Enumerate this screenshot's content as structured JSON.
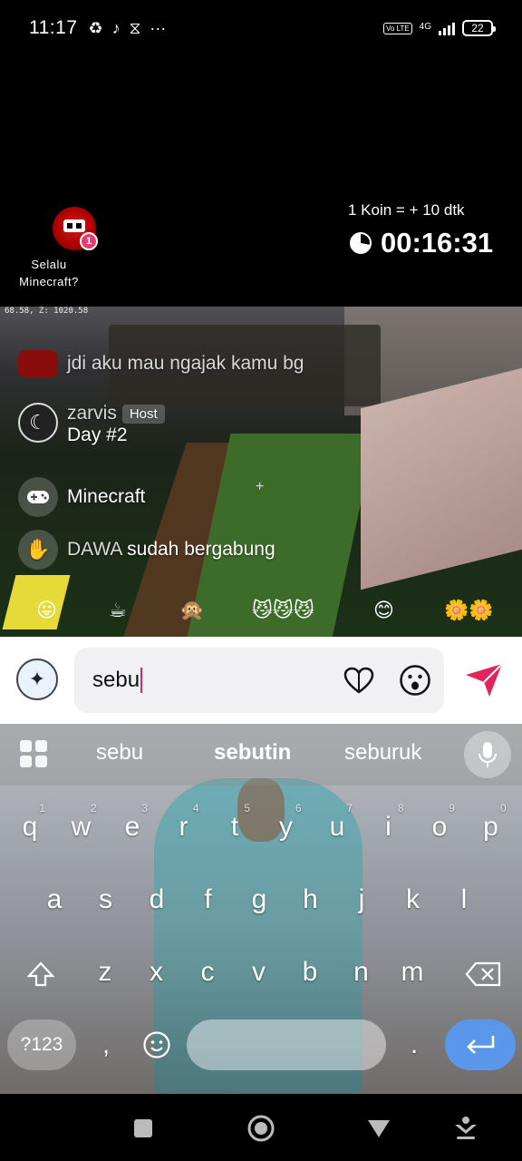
{
  "status_bar": {
    "time": "11:17",
    "left_icons": [
      "refresh-icon",
      "tiktok-icon",
      "capcut-icon",
      "more-dots-icon"
    ],
    "more_dots": "···",
    "volte": "Vo LTE",
    "network": "4G",
    "battery": "22"
  },
  "live": {
    "channel_name_line1": "Selalu",
    "channel_name_line2": "Minecraft?",
    "avatar_badge": "1",
    "coin_rate": "1 Koin = + 10 dtk",
    "timer": "00:16:31"
  },
  "game": {
    "coords": "68.58, Z: 1020.58",
    "crosshair": "+"
  },
  "chat": [
    {
      "user": "",
      "text": "jdi aku mau ngajak kamu bg"
    },
    {
      "user": "zarvis",
      "badge": "Host",
      "text": "Day #2"
    },
    {
      "user": "",
      "text": "Minecraft"
    },
    {
      "user": "DAWA",
      "text": "sudah bergabung"
    }
  ],
  "gifts": [
    "😛",
    "☕",
    "🙊",
    "😼😼😼",
    "😊",
    "🌼🌼"
  ],
  "comment_input": {
    "value": "sebu"
  },
  "keyboard": {
    "suggestions": [
      "sebu",
      "sebutin",
      "seburuk"
    ],
    "row1": [
      "q",
      "w",
      "e",
      "r",
      "t",
      "y",
      "u",
      "i",
      "o",
      "p"
    ],
    "row1_hints": [
      "1",
      "2",
      "3",
      "4",
      "5",
      "6",
      "7",
      "8",
      "9",
      "0"
    ],
    "row2": [
      "a",
      "s",
      "d",
      "f",
      "g",
      "h",
      "j",
      "k",
      "l"
    ],
    "row3": [
      "z",
      "x",
      "c",
      "v",
      "b",
      "n",
      "m"
    ],
    "symbols_key": "?123",
    "comma_key": ",",
    "period_key": "."
  },
  "colors": {
    "accent_pink": "#e0245e",
    "enter_blue": "#5a97ea"
  }
}
